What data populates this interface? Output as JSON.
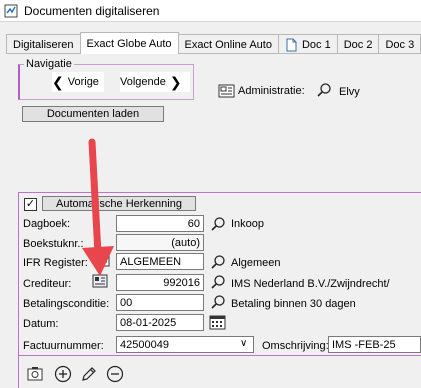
{
  "window": {
    "title": "Documenten digitaliseren"
  },
  "tabs": [
    {
      "label": "Digitaliseren"
    },
    {
      "label": "Exact Globe Auto"
    },
    {
      "label": "Exact Online Auto"
    },
    {
      "label": "Doc 1"
    },
    {
      "label": "Doc 2"
    },
    {
      "label": "Doc 3"
    }
  ],
  "navigation": {
    "legend": "Navigatie",
    "prev_label": "Vorige",
    "next_label": "Volgende"
  },
  "administration": {
    "label": "Administratie:",
    "value": "Elvy"
  },
  "buttons": {
    "load_documents": "Documenten laden",
    "auto_recognition": "Automatische Herkenning"
  },
  "auto_recognition_checked": true,
  "form": {
    "dagboek": {
      "label": "Dagboek:",
      "value": "60",
      "desc": "Inkoop"
    },
    "boekstuknr": {
      "label": "Boekstuknr.:",
      "value": "(auto)"
    },
    "ifr": {
      "label": "IFR Register:",
      "value": "ALGEMEEN",
      "desc": "Algemeen"
    },
    "crediteur": {
      "label": "Crediteur:",
      "value": "992016",
      "desc": "IMS Nederland B.V./Zwijndrecht/"
    },
    "betalingsconditie": {
      "label": "Betalingsconditie:",
      "value": "00",
      "desc": "Betaling binnen 30 dagen"
    },
    "datum": {
      "label": "Datum:",
      "value": "08-01-2025"
    },
    "factuurnummer": {
      "label": "Factuurnummer:",
      "value": "42500049"
    },
    "omschrijving": {
      "label": "Omschrijving:",
      "value": "IMS -FEB-25"
    }
  },
  "colors": {
    "accent_frame": "#c070d0",
    "arrow": "#e8454c"
  }
}
